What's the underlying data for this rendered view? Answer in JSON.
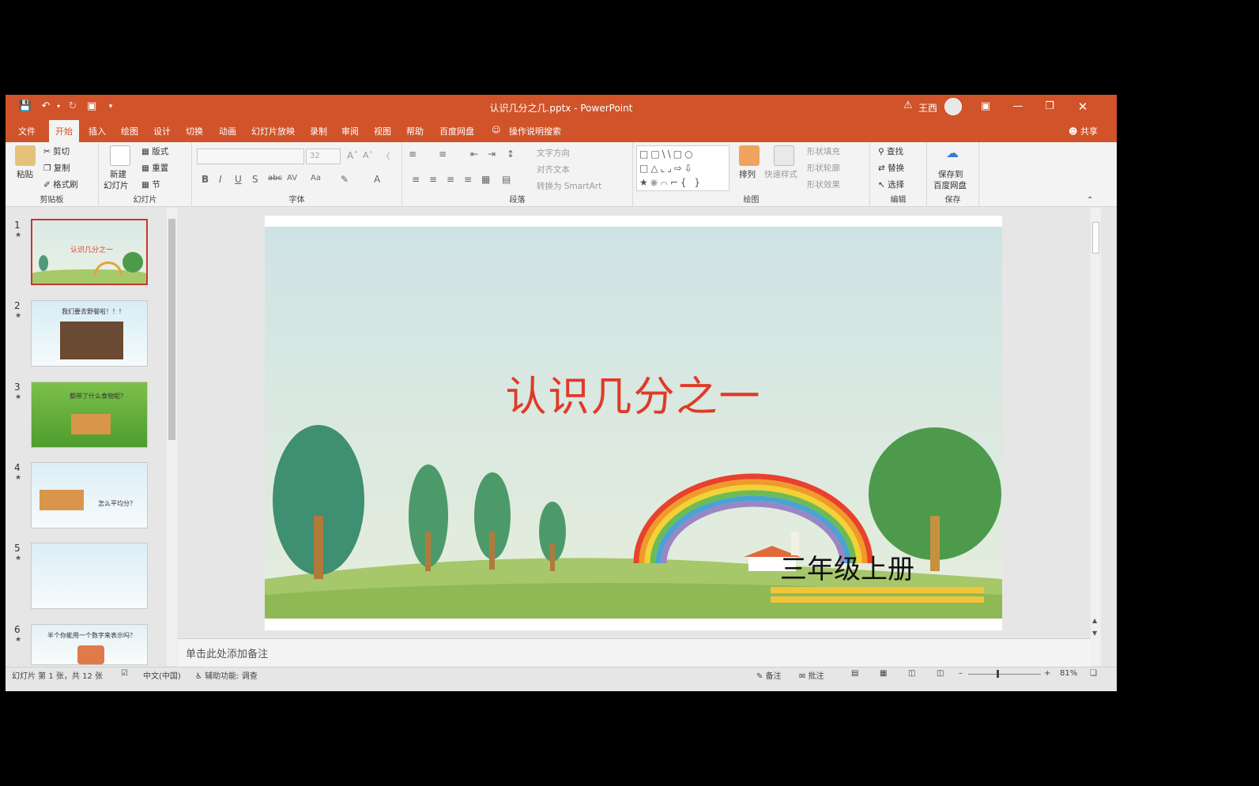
{
  "titlebar": {
    "doc_title": "认识几分之几.pptx - PowerPoint",
    "user_name": "王西",
    "warning_icon": "warning-icon",
    "accent": "#d0532a"
  },
  "tabs": [
    "文件",
    "开始",
    "插入",
    "绘图",
    "设计",
    "切换",
    "动画",
    "幻灯片放映",
    "录制",
    "审阅",
    "视图",
    "帮助",
    "百度网盘",
    "操作说明搜索"
  ],
  "share_label": "共享",
  "ribbon": {
    "clipboard": {
      "paste": "粘贴",
      "cut": "剪切",
      "copy": "复制",
      "format_painter": "格式刷",
      "label": "剪贴板"
    },
    "slides": {
      "new_slide_1": "新建",
      "new_slide_2": "幻灯片",
      "layout": "版式",
      "reset": "重置",
      "section": "节",
      "label": "幻灯片"
    },
    "font": {
      "size": "32",
      "label": "字体"
    },
    "paragraph": {
      "text_direction": "文字方向",
      "align_text": "对齐文本",
      "convert_smartart": "转换为 SmartArt",
      "label": "段落"
    },
    "drawing": {
      "arrange": "排列",
      "quick_styles": "快速样式",
      "shape_fill": "形状填充",
      "shape_outline": "形状轮廓",
      "shape_effects": "形状效果",
      "label": "绘图"
    },
    "editing": {
      "find": "查找",
      "replace": "替换",
      "select": "选择",
      "label": "编辑"
    },
    "save": {
      "save_to_1": "保存到",
      "save_to_2": "百度网盘",
      "label": "保存"
    }
  },
  "thumbnails": [
    {
      "num": "1",
      "title": "认识几分之一"
    },
    {
      "num": "2",
      "title": "我们要去野餐啦！！！"
    },
    {
      "num": "3",
      "title": "都带了什么食物呢？"
    },
    {
      "num": "4",
      "title": "怎么平均分？"
    },
    {
      "num": "5",
      "title": ""
    },
    {
      "num": "6",
      "title": "半个你能用一个数字来表示吗？"
    }
  ],
  "slide": {
    "title": "认识几分之一",
    "subtitle": "三年级上册",
    "title_color": "#e03a28"
  },
  "notes_placeholder": "单击此处添加备注",
  "status": {
    "slide_info": "幻灯片 第 1 张，共 12 张",
    "language": "中文(中国)",
    "accessibility": "辅助功能: 调查",
    "notes": "备注",
    "comments": "批注",
    "zoom": "81%"
  }
}
